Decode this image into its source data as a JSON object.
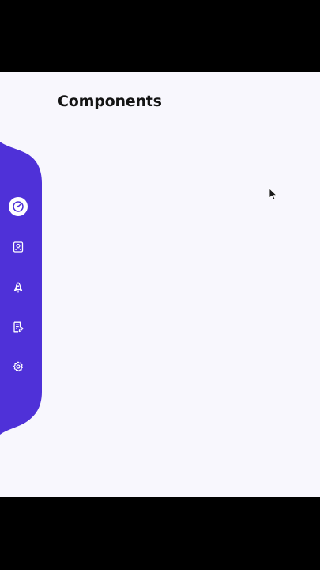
{
  "page": {
    "title": "Components"
  },
  "sidebar": {
    "items": [
      {
        "icon": "speedometer-icon",
        "active": true
      },
      {
        "icon": "contact-card-icon",
        "active": false
      },
      {
        "icon": "rocket-icon",
        "active": false
      },
      {
        "icon": "document-edit-icon",
        "active": false
      },
      {
        "icon": "gear-icon",
        "active": false
      }
    ]
  },
  "colors": {
    "sidebar": "#4f31d8",
    "background": "#f8f7fd",
    "title": "#141414",
    "icon": "#ffffff",
    "active_icon": "#4f31d8"
  }
}
